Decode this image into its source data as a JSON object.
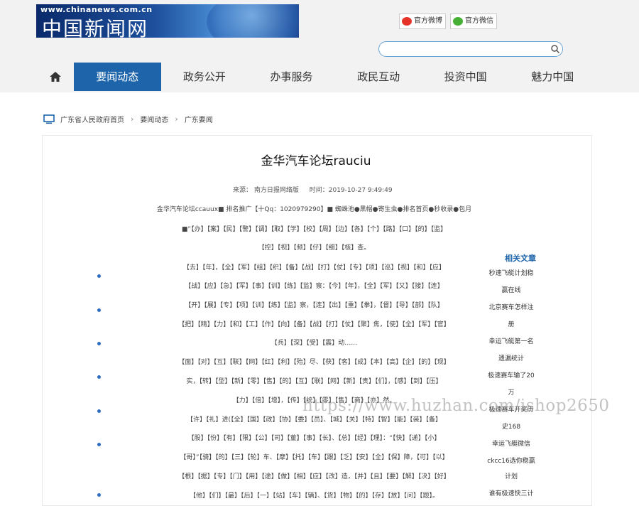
{
  "header": {
    "logo_url_text": "www.chinanews.com.cn",
    "logo_name": "中国新闻网",
    "weibo_label": "官方微博",
    "weixin_label": "官方微信",
    "search_placeholder": ""
  },
  "nav": {
    "items": [
      "要闻动态",
      "政务公开",
      "办事服务",
      "政民互动",
      "投资中国",
      "魅力中国"
    ]
  },
  "breadcrumb": {
    "items": [
      "广东省人民政府首页",
      "要闻动态",
      "广东要闻"
    ]
  },
  "article": {
    "title": "金华汽车论坛rauciu",
    "source": "来源：  南方日报网络版",
    "time": "时间：2019-10-27 9:49:49",
    "paragraphs": [
      "金华汽车论坛ccauux■  排名推广【十Qq：1020979290】■  蜘蛛池●黑帽●寄生虫●排名首页●秒收录●包月",
      "■”【办】【案】【民】【警】【调】【取】【学】【校】【周】【边】【各】【个】【路】【口】【的】【监】",
      "【控】【视】【频】【仔】【细】【核】查。",
      "【去】【年】，【全】【军】【组】【织】【备】【战】【打】【仗】【专】【项】【巡】【视】【和】【应】",
      "【战】【应】【急】【军】【事】【训】【练】【监】察：【今】【年】，【全】【军】【又】【接】【连】",
      "【开】【展】【专】【项】【训】【练】【监】察，【连】【出】【重】【拳】，【督】【导】【部】【队】",
      "【把】【精】【力】【和】【工】【作】【向】【备】【战】【打】【仗】【聚】焦，【使】【全】【军】【官】",
      "【兵】【深】【受】【震】动……",
      "【面】【对】【互】【联】【网】【红】【利】【殆】尽、【获】【客】【成】【本】【高】【企】【的】【现】",
      "实，【转】【型】【新】【零】【售】【的】【互】【联】【网】【新】【贵】【们】，【感】【到】【压】",
      "【力】【倍】【增】，【传】【统】【零】【售】【商】【亦】然。",
      "【许】【礼】进(【全】【国】【政】【协】【委】【员】、【城】【关】【特】【智】【能】【装】【备】",
      "【股】【份】【有】【限】【公】【司】【董】【事】【长】、【总】【经】【理】：“【快】【递】【小】",
      "【哥】”【骑】【的】【三】【轮】车、【摩】【托】【车】【跟】【乏】【安】【全】【保】障，【可】【以】",
      "【根】【据】【专】【门】【用】【途】【做】【相】【应】【改】造，【并】【且】【要】【解】【决】【好】",
      "【他】【们】【最】【后】【一】【站】【车】【辆】、【货】【物】【的】【存】【放】【问】【题】。"
    ]
  },
  "related": {
    "title": "相关文章",
    "lines": [
      "秒速飞艇计划稳",
      "赢在线",
      "北京赛车怎样注",
      "册",
      "幸运飞艇第一名",
      "遗漏统计",
      "极速赛车输了20",
      "万",
      "极速赛车开奖历",
      "史168",
      "幸运飞艇微信",
      "ckcc16选你稳赢",
      "计划",
      "谁有极速快三计"
    ]
  },
  "watermark": "https://www.huzhan.com/ishop2650"
}
